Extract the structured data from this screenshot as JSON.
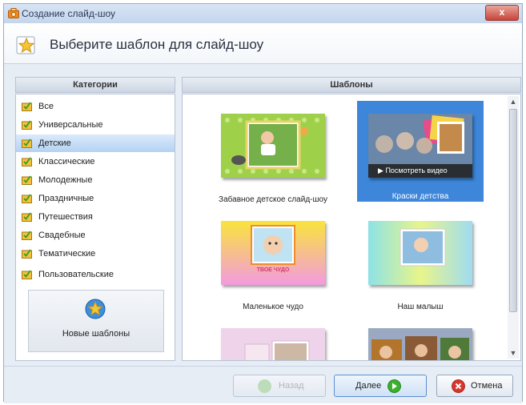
{
  "window": {
    "title": "Создание слайд-шоу",
    "close_label": "x"
  },
  "header": {
    "title": "Выберите шаблон для слайд-шоу"
  },
  "categories_panel": {
    "heading": "Категории",
    "items": [
      {
        "label": "Все",
        "selected": false
      },
      {
        "label": "Универсальные",
        "selected": false
      },
      {
        "label": "Детские",
        "selected": true
      },
      {
        "label": "Классические",
        "selected": false
      },
      {
        "label": "Молодежные",
        "selected": false
      },
      {
        "label": "Праздничные",
        "selected": false
      },
      {
        "label": "Путешествия",
        "selected": false
      },
      {
        "label": "Свадебные",
        "selected": false
      },
      {
        "label": "Тематические",
        "selected": false
      },
      {
        "label": "Пользовательские",
        "selected": false
      }
    ],
    "new_templates_label": "Новые шаблоны"
  },
  "templates_panel": {
    "heading": "Шаблоны",
    "items": [
      {
        "label": "Забавное детское слайд-шоу",
        "selected": false
      },
      {
        "label": "Краски детства",
        "selected": true,
        "preview_label": "Посмотреть видео"
      },
      {
        "label": "Маленькое чудо",
        "selected": false,
        "thumb_caption": "ТВОЕ ЧУДО"
      },
      {
        "label": "Наш малыш",
        "selected": false
      },
      {
        "label": "",
        "selected": false
      },
      {
        "label": "",
        "selected": false
      }
    ]
  },
  "footer": {
    "back_label": "Назад",
    "next_label": "Далее",
    "cancel_label": "Отмена"
  },
  "colors": {
    "selection": "#3d86d9",
    "category_selection": "#c3dbf5",
    "next_icon": "#3bb02f",
    "cancel_icon": "#d9362c"
  }
}
